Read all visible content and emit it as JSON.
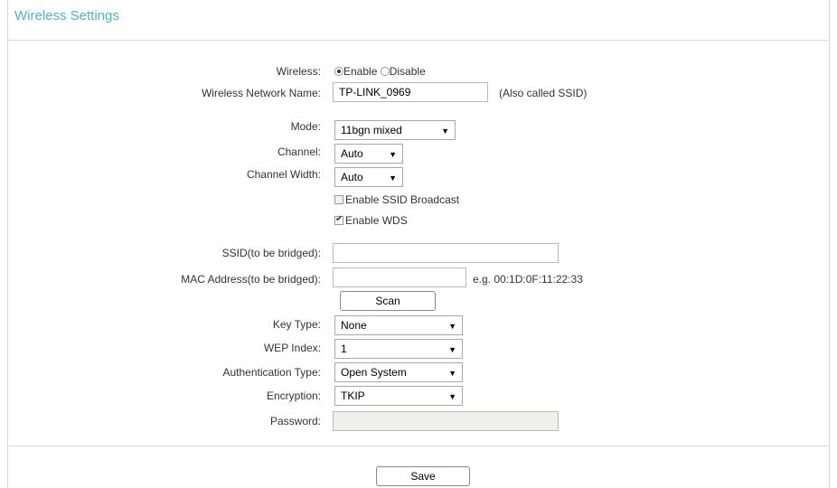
{
  "page": {
    "title": "Wireless Settings"
  },
  "wireless": {
    "label": "Wireless:",
    "enable_label": "Enable",
    "disable_label": "Disable",
    "selected": "Enable"
  },
  "network_name": {
    "label": "Wireless Network Name:",
    "value": "TP-LINK_0969",
    "hint": "(Also called SSID)"
  },
  "mode": {
    "label": "Mode:",
    "value": "11bgn mixed"
  },
  "channel": {
    "label": "Channel:",
    "value": "Auto"
  },
  "channel_width": {
    "label": "Channel Width:",
    "value": "Auto"
  },
  "ssid_broadcast": {
    "label": "Enable SSID Broadcast",
    "checked": false
  },
  "wds": {
    "label": "Enable WDS",
    "checked": true
  },
  "ssid_bridged": {
    "label": "SSID(to be bridged):",
    "value": ""
  },
  "mac_bridged": {
    "label": "MAC Address(to be bridged):",
    "value": "",
    "hint": "e.g. 00:1D:0F:11:22:33"
  },
  "scan_button": {
    "label": "Scan"
  },
  "key_type": {
    "label": "Key Type:",
    "value": "None"
  },
  "wep_index": {
    "label": "WEP Index:",
    "value": "1"
  },
  "auth_type": {
    "label": "Authentication Type:",
    "value": "Open System"
  },
  "encryption": {
    "label": "Encryption:",
    "value": "TKIP"
  },
  "password": {
    "label": "Password:",
    "value": ""
  },
  "save_button": {
    "label": "Save"
  }
}
